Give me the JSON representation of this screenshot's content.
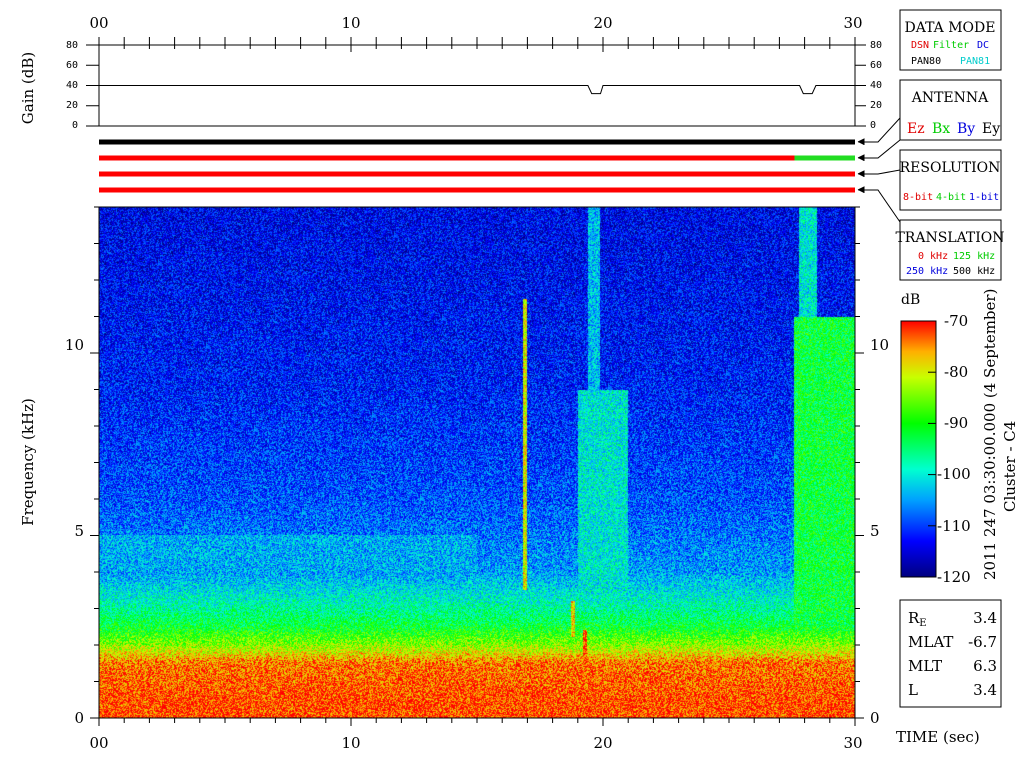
{
  "time_axis": {
    "ticks": [
      "00",
      "10",
      "20",
      "30"
    ],
    "label": "TIME (sec)"
  },
  "gain_panel": {
    "ylabel": "Gain (dB)",
    "ticks": [
      "0",
      "20",
      "40",
      "60",
      "80"
    ]
  },
  "spectrogram_panel": {
    "ylabel": "Frequency (kHz)",
    "ticks": [
      "0",
      "5",
      "10"
    ]
  },
  "legend": {
    "data_mode": {
      "title": "DATA MODE",
      "items": [
        {
          "text": "DSN",
          "color": "#e00000"
        },
        {
          "text": "Filter",
          "color": "#00cc00"
        },
        {
          "text": "DC",
          "color": "#0000dd"
        },
        {
          "text": "PAN80",
          "color": "#000000"
        },
        {
          "text": "PAN81",
          "color": "#00cccc"
        }
      ]
    },
    "antenna": {
      "title": "ANTENNA",
      "items": [
        {
          "text": "Ez",
          "color": "#e00000"
        },
        {
          "text": "Bx",
          "color": "#00cc00"
        },
        {
          "text": "By",
          "color": "#0000dd"
        },
        {
          "text": "Ey",
          "color": "#000000"
        }
      ]
    },
    "resolution": {
      "title": "RESOLUTION",
      "items": [
        {
          "text": "8-bit",
          "color": "#e00000"
        },
        {
          "text": "4-bit",
          "color": "#00cc00"
        },
        {
          "text": "1-bit",
          "color": "#0000dd"
        }
      ]
    },
    "translation": {
      "title": "TRANSLATION",
      "items": [
        {
          "text": "0 kHz",
          "color": "#e00000"
        },
        {
          "text": "125 kHz",
          "color": "#00cc00"
        },
        {
          "text": "250 kHz",
          "color": "#0000dd"
        },
        {
          "text": "500 kHz",
          "color": "#000000"
        }
      ]
    }
  },
  "colorbar": {
    "unit": "dB",
    "ticks": [
      "-70",
      "-80",
      "-90",
      "-100",
      "-110",
      "-120"
    ]
  },
  "side_title": "2011 247 03:30:00.000 (4 September)",
  "side_subtitle": "Cluster - C4",
  "orbit": {
    "rows": [
      {
        "label": "R",
        "sub": "E",
        "value": "3.4"
      },
      {
        "label": "MLAT",
        "sub": "",
        "value": "-6.7"
      },
      {
        "label": "MLT",
        "sub": "",
        "value": "6.3"
      },
      {
        "label": "L",
        "sub": "",
        "value": "3.4"
      }
    ]
  },
  "chart_data": [
    {
      "type": "line",
      "title": "",
      "xlabel": "",
      "ylabel": "Gain (dB)",
      "xlim": [
        0,
        30
      ],
      "ylim": [
        0,
        80
      ],
      "series": [
        {
          "x": [
            0,
            19.4,
            19.55,
            19.9,
            20.0,
            27.8,
            27.95,
            28.3,
            28.45,
            30
          ],
          "values": [
            40,
            40,
            32,
            32,
            40,
            40,
            32,
            32,
            40,
            40
          ]
        }
      ]
    },
    {
      "type": "table",
      "rows": [
        {
          "segments": [
            {
              "from": 0,
              "to": 30,
              "color": "#000000"
            }
          ]
        },
        {
          "segments": [
            {
              "from": 0,
              "to": 27.6,
              "color": "#ff0000"
            },
            {
              "from": 27.6,
              "to": 30,
              "color": "#22dd22"
            }
          ]
        },
        {
          "segments": [
            {
              "from": 0,
              "to": 30,
              "color": "#ff0000"
            }
          ]
        },
        {
          "segments": [
            {
              "from": 0,
              "to": 30,
              "color": "#ff0000"
            }
          ]
        }
      ]
    },
    {
      "type": "heatmap",
      "xlabel": "TIME (sec)",
      "ylabel": "Frequency (kHz)",
      "xlim": [
        0,
        30
      ],
      "ylim": [
        0,
        14
      ],
      "zlim": [
        -120,
        -70
      ],
      "z_unit": "dB",
      "profile": [
        {
          "f": 0.0,
          "db": -72
        },
        {
          "f": 0.5,
          "db": -72
        },
        {
          "f": 1.5,
          "db": -74
        },
        {
          "f": 2.0,
          "db": -84
        },
        {
          "f": 2.5,
          "db": -92
        },
        {
          "f": 3.0,
          "db": -97
        },
        {
          "f": 4.0,
          "db": -105
        },
        {
          "f": 6.0,
          "db": -109
        },
        {
          "f": 9.0,
          "db": -112
        },
        {
          "f": 14.0,
          "db": -114
        }
      ],
      "features": [
        {
          "kind": "band",
          "t_from": 27.6,
          "t_to": 30,
          "f_from": 0,
          "f_to": 11,
          "db": -92
        },
        {
          "kind": "band",
          "t_from": 19.0,
          "t_to": 21.0,
          "f_from": 3,
          "f_to": 9,
          "db": -100
        },
        {
          "kind": "band",
          "t_from": 27.8,
          "t_to": 28.5,
          "f_from": 0,
          "f_to": 14,
          "db": -100
        },
        {
          "kind": "band",
          "t_from": 19.4,
          "t_to": 19.9,
          "f_from": 3,
          "f_to": 14,
          "db": -103
        },
        {
          "kind": "band",
          "t_from": 0,
          "t_to": 15,
          "f_from": 4,
          "f_to": 5,
          "db": -104
        },
        {
          "kind": "line",
          "t": 16.9,
          "f_from": 3.5,
          "f_to": 11.5,
          "db": -80
        },
        {
          "kind": "streak",
          "t": 18.8,
          "f_from": 2.2,
          "f_to": 3.2,
          "db": -78
        },
        {
          "kind": "streak",
          "t": 19.3,
          "f_from": 1.5,
          "f_to": 2.4,
          "db": -72
        }
      ]
    }
  ]
}
